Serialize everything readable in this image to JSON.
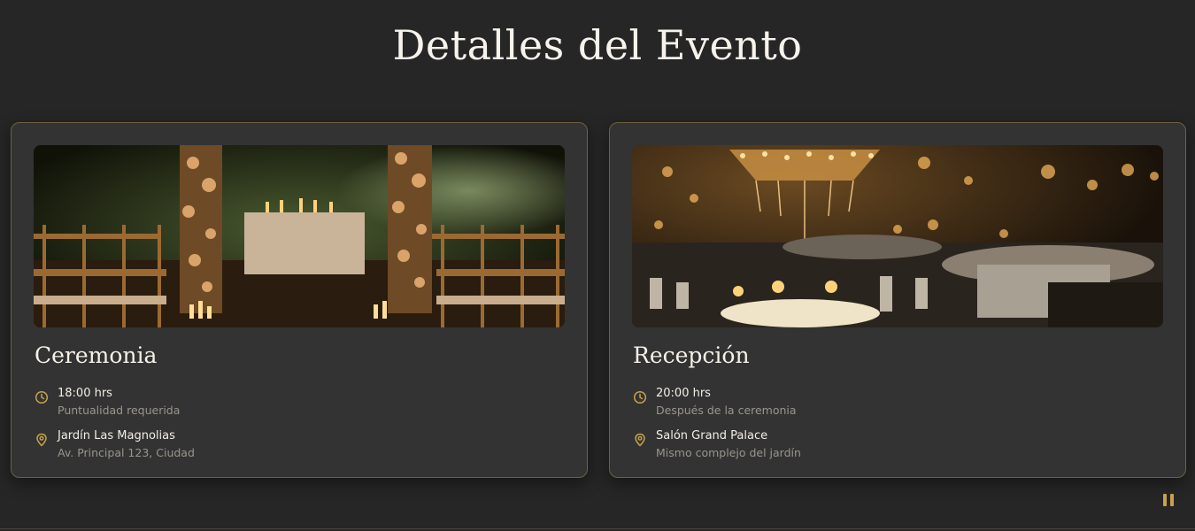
{
  "page": {
    "title": "Detalles del Evento"
  },
  "cards": [
    {
      "title": "Ceremonia",
      "image": "ceremony-garden-candles-photo",
      "time": {
        "icon": "clock-icon",
        "main": "18:00 hrs",
        "sub": "Puntualidad requerida"
      },
      "place": {
        "icon": "map-pin-icon",
        "main": "Jardín Las Magnolias",
        "sub": "Av. Principal 123, Ciudad"
      }
    },
    {
      "title": "Recepción",
      "image": "reception-chandelier-hall-photo",
      "time": {
        "icon": "clock-icon",
        "main": "20:00 hrs",
        "sub": "Después de la ceremonia"
      },
      "place": {
        "icon": "map-pin-icon",
        "main": "Salón Grand Palace",
        "sub": "Mismo complejo del jardín"
      }
    }
  ],
  "controls": {
    "pause": "pause-icon"
  },
  "colors": {
    "background": "#262626",
    "card": "#333333",
    "accent": "#c8a24e",
    "border": "#6e6142"
  }
}
